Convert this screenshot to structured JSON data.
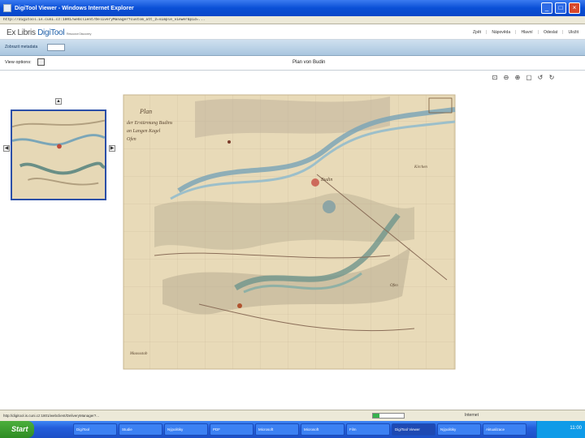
{
  "window": {
    "title": "DigiTool Viewer - Windows Internet Explorer",
    "address": "http://digitool.is.cuni.cz:1801/webclient/DeliveryManager?custom_att_2=simple_viewer&pid=..."
  },
  "header": {
    "logo_prefix": "Ex Libris",
    "logo_brand": "DigiTool",
    "logo_sub": "Resource Discovery",
    "menu": [
      "Zpět",
      "Nápověda",
      "Hlavní",
      "Odeslat",
      "Uložit"
    ]
  },
  "navbar": {
    "label": "Zobrazit metadata"
  },
  "toolbar": {
    "view_options": "View options:",
    "doc_title": "Plan von Budin"
  },
  "tools": [
    "fit-icon",
    "zoom-out-icon",
    "zoom-in-icon",
    "zoom-window-icon",
    "rotate-left-icon",
    "rotate-right-icon"
  ],
  "map": {
    "title_lines": [
      "Plan",
      "der Erstürmung Budins",
      "an Langen Kagel",
      "Ofen"
    ],
    "places": [
      "Budin",
      "Kirchen",
      "Ofen"
    ],
    "bottom_note": "Maassstab"
  },
  "statusbar": {
    "text": "http://digitool.is.cuni.cz:1801/webclient/DeliveryManager?...",
    "zone": "Internet",
    "progress_percent": 20
  },
  "taskbar": {
    "start_label": "Start",
    "tasks": [
      "DigiTool",
      "Studie",
      "Nýpolitiky",
      "PDF",
      "Microsoft",
      "Microsoft",
      "Film",
      "DigiTool Viewer",
      "Nýpolitiky",
      "Aktualizace"
    ],
    "active_task_index": 7,
    "clock": "11:00"
  },
  "colors": {
    "titlebar": "#0a4fd6",
    "navbar": "#a9c6df",
    "taskbar": "#245edb",
    "map_paper": "#e9dcbc"
  }
}
